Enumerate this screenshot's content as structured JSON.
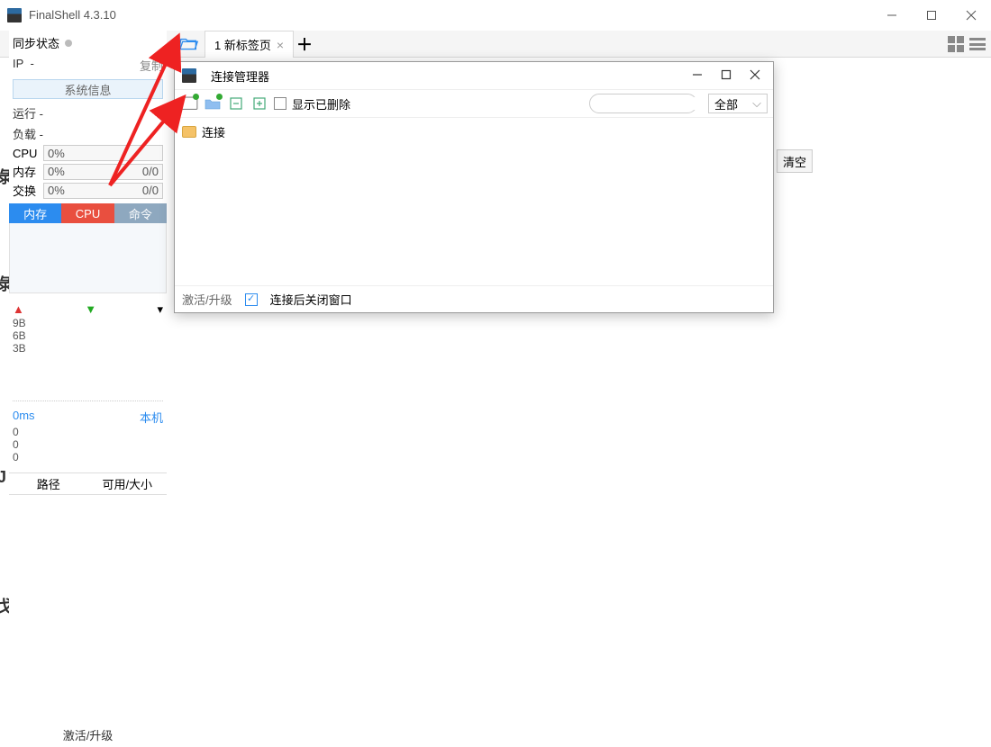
{
  "app": {
    "title": "FinalShell 4.3.10"
  },
  "tabstrip": {
    "tab_label": "1 新标签页",
    "add_tooltip": "+"
  },
  "sidebar": {
    "sync_label": "同步状态",
    "ip_label": "IP",
    "ip_value": "-",
    "copy_label": "复制",
    "sysinfo_btn": "系统信息",
    "run_label": "运行 -",
    "load_label": "负载 -",
    "cpu_label": "CPU",
    "cpu_value": "0%",
    "mem_label": "内存",
    "mem_value": "0%",
    "mem_ratio": "0/0",
    "swap_label": "交换",
    "swap_value": "0%",
    "swap_ratio": "0/0",
    "mon_tabs": {
      "mem": "内存",
      "cpu": "CPU",
      "cmd": "命令"
    },
    "net_y": [
      "9B",
      "6B",
      "3B"
    ],
    "ping_ms": "0ms",
    "ping_host": "本机",
    "ping_vals": [
      "0",
      "0",
      "0"
    ],
    "disk_cols": {
      "path": "路径",
      "free": "可用/大小"
    },
    "activate": "激活/升级"
  },
  "clear_btn": "清空",
  "dialog": {
    "title": "连接管理器",
    "show_deleted": "显示已删除",
    "filter": "全部",
    "tree_root": "连接",
    "footer_upgrade": "激活/升级",
    "footer_close": "连接后关闭窗口"
  },
  "edge_chars": {
    "a": "彔",
    "b": "彔",
    "c": "J",
    "d": "戈"
  }
}
